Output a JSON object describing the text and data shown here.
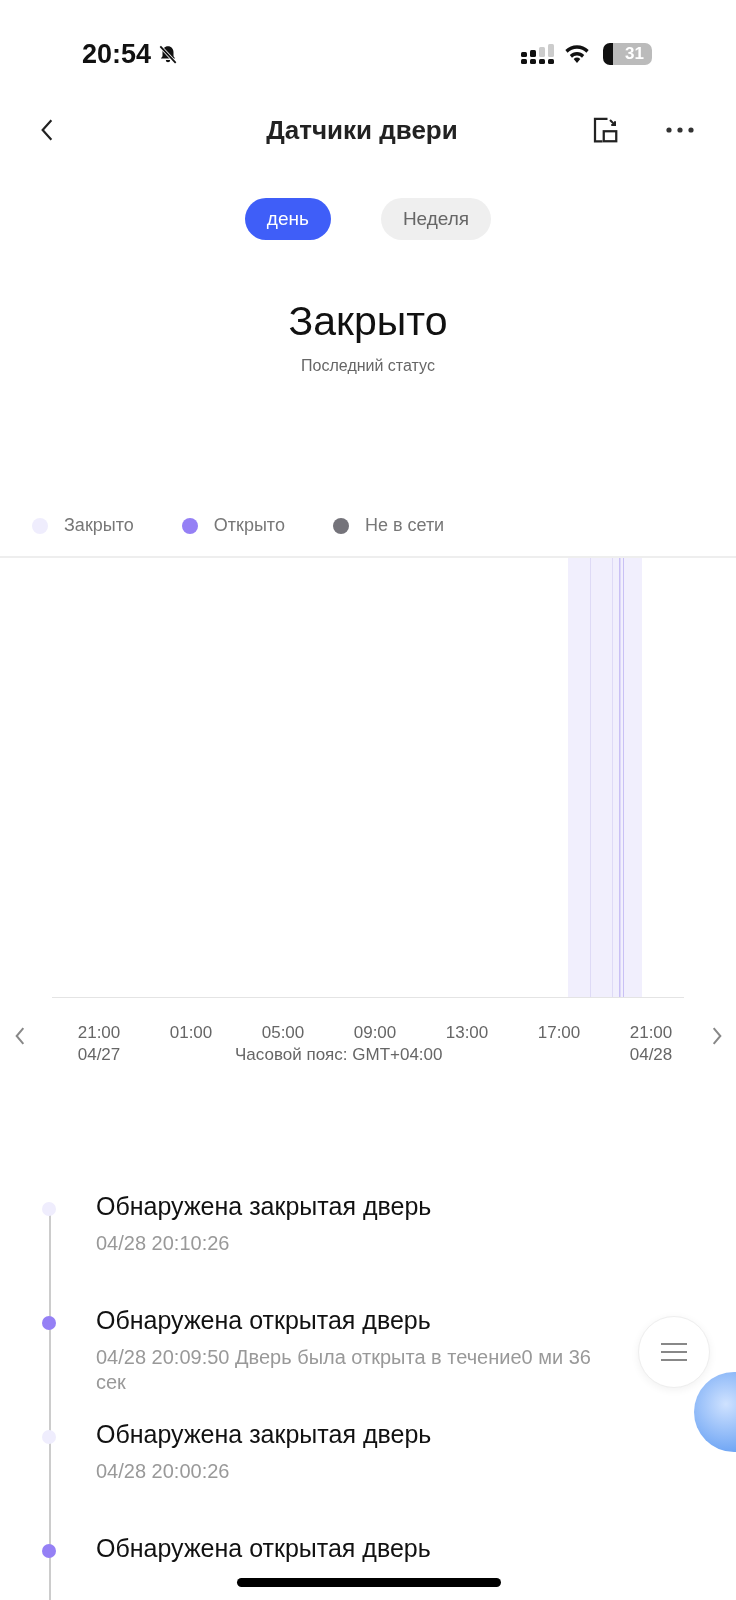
{
  "status_bar": {
    "time": "20:54",
    "battery": "31"
  },
  "header": {
    "title": "Датчики двери"
  },
  "tabs": [
    {
      "label": "день",
      "selected": true
    },
    {
      "label": "Неделя",
      "selected": false
    }
  ],
  "status": {
    "value": "Закрыто",
    "caption": "Последний статус"
  },
  "legend": [
    {
      "label": "Закрыто",
      "color": "#efedfd"
    },
    {
      "label": "Открыто",
      "color": "#9580f5"
    },
    {
      "label": "Не в сети",
      "color": "#74737a"
    }
  ],
  "chart": {
    "x_ticks": [
      {
        "time": "21:00",
        "date": "04/27"
      },
      {
        "time": "01:00"
      },
      {
        "time": "05:00"
      },
      {
        "time": "09:00"
      },
      {
        "time": "13:00"
      },
      {
        "time": "17:00"
      },
      {
        "time": "21:00",
        "date": "04/28"
      }
    ],
    "timezone": "Часовой пояс: GMT+04:00"
  },
  "events": [
    {
      "kind": "closed",
      "title": "Обнаружена закрытая дверь",
      "detail": "04/28 20:10:26"
    },
    {
      "kind": "open",
      "title": "Обнаружена открытая дверь",
      "detail": "04/28 20:09:50 Дверь была открыта в течение0 ми 36 сек"
    },
    {
      "kind": "closed",
      "title": "Обнаружена закрытая дверь",
      "detail": "04/28 20:00:26"
    },
    {
      "kind": "open",
      "title": "Обнаружена открытая дверь"
    }
  ]
}
